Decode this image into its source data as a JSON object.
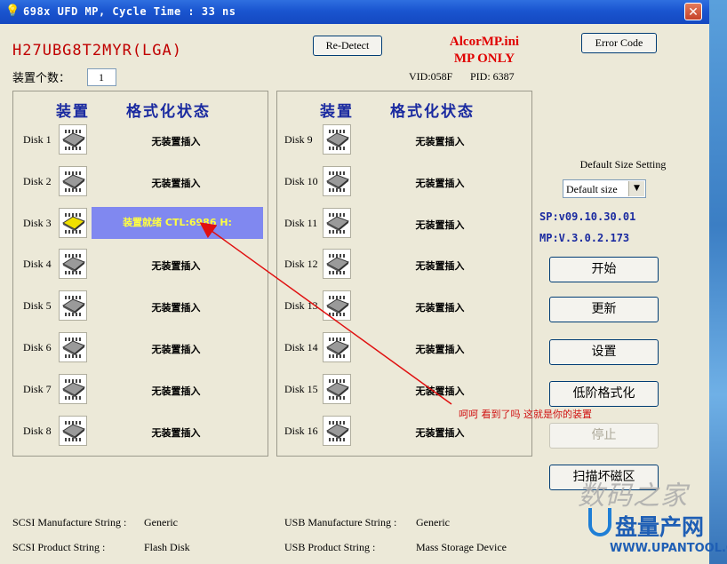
{
  "window": {
    "title": "698x UFD MP, Cycle Time : 33 ns",
    "close_glyph": "✕"
  },
  "header": {
    "model": "H27UBG8T2MYR(LGA)",
    "redetect_label": "Re-Detect",
    "app_name_line1": "AlcorMP.ini",
    "app_name_line2": "MP ONLY",
    "error_code_label": "Error Code",
    "device_count_label": "装置个数：",
    "device_count_value": "1",
    "vid": "VID:058F",
    "pid": "PID: 6387"
  },
  "panels": [
    {
      "col_device": "装置",
      "col_status": "格式化状态",
      "disks": [
        {
          "label": "Disk 1",
          "status": "无装置插入",
          "ready": false
        },
        {
          "label": "Disk 2",
          "status": "无装置插入",
          "ready": false
        },
        {
          "label": "Disk 3",
          "status": "装置就绪 CTL:6986 H:",
          "ready": true
        },
        {
          "label": "Disk 4",
          "status": "无装置插入",
          "ready": false
        },
        {
          "label": "Disk 5",
          "status": "无装置插入",
          "ready": false
        },
        {
          "label": "Disk 6",
          "status": "无装置插入",
          "ready": false
        },
        {
          "label": "Disk 7",
          "status": "无装置插入",
          "ready": false
        },
        {
          "label": "Disk 8",
          "status": "无装置插入",
          "ready": false
        }
      ]
    },
    {
      "col_device": "装置",
      "col_status": "格式化状态",
      "disks": [
        {
          "label": "Disk 9",
          "status": "无装置插入",
          "ready": false
        },
        {
          "label": "Disk 10",
          "status": "无装置插入",
          "ready": false
        },
        {
          "label": "Disk 11",
          "status": "无装置插入",
          "ready": false
        },
        {
          "label": "Disk 12",
          "status": "无装置插入",
          "ready": false
        },
        {
          "label": "Disk 13",
          "status": "无装置插入",
          "ready": false
        },
        {
          "label": "Disk 14",
          "status": "无装置插入",
          "ready": false
        },
        {
          "label": "Disk 15",
          "status": "无装置插入",
          "ready": false
        },
        {
          "label": "Disk 16",
          "status": "无装置插入",
          "ready": false
        }
      ]
    }
  ],
  "settings": {
    "size_setting_label": "Default Size Setting",
    "size_selected": "Default size",
    "sp_version": "SP:v09.10.30.01",
    "mp_version": "MP:V.3.0.2.173"
  },
  "controls": {
    "start": "开始",
    "update": "更新",
    "settings": "设置",
    "low_format": "低阶格式化",
    "stop": "停止",
    "scan_bad": "扫描坏磁区"
  },
  "strings": {
    "scsi_manufacture_label": "SCSI Manufacture String :",
    "scsi_manufacture_value": "Generic",
    "scsi_product_label": "SCSI Product String :",
    "scsi_product_value": "Flash Disk",
    "usb_manufacture_label": "USB Manufacture String :",
    "usb_manufacture_value": "Generic",
    "usb_product_label": "USB Product String :",
    "usb_product_value": "Mass Storage Device"
  },
  "annotation": "呵呵 看到了吗 这就是你的装置",
  "watermark": {
    "cn": "数码之家",
    "brand": "盘量产网",
    "url": "WWW.UPANTOOL.COM"
  },
  "colors": {
    "ready_bg": "#8088f0",
    "ready_text": "#ffff40",
    "header_blue": "#1a2aa0",
    "model_red": "#c00000",
    "chip_ready": "#f0e000",
    "chip_idle": "#9a9a9a"
  }
}
